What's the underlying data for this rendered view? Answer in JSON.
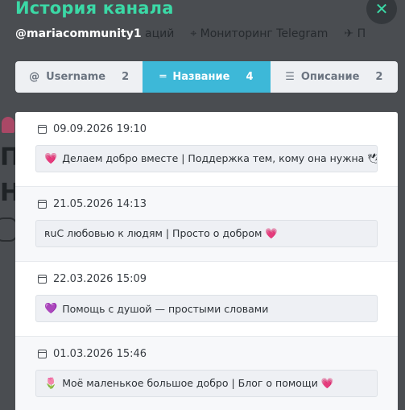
{
  "background": {
    "nav_items": [
      "аций",
      "Мониторинг Telegram",
      "П"
    ]
  },
  "modal": {
    "title": "История канала",
    "channel": "@mariacommunity1",
    "close_icon": "close-icon",
    "accent": "#3bd9a6"
  },
  "tabs": [
    {
      "icon": "at-icon",
      "label": "Username",
      "count": "2",
      "active": false
    },
    {
      "icon": "text-lines-icon",
      "label": "Название",
      "count": "4",
      "active": true
    },
    {
      "icon": "paragraph-icon",
      "label": "Описание",
      "count": "2",
      "active": false
    }
  ],
  "entries": [
    {
      "date": "09.09.2026 19:10",
      "emoji": "💗",
      "text": "Делаем добро вместе | Поддержка тем, кому она нужна 🕊"
    },
    {
      "date": "21.05.2026 14:13",
      "emoji": "",
      "text": "ʀuС любовью к людям | Просто о добром 💗"
    },
    {
      "date": "22.03.2026 15:09",
      "emoji": "💜",
      "text": "Помощь с душой — простыми словами"
    },
    {
      "date": "01.03.2026 15:46",
      "emoji": "🌷",
      "text": "Моё маленькое большое добро | Блог о помощи 💗"
    }
  ]
}
